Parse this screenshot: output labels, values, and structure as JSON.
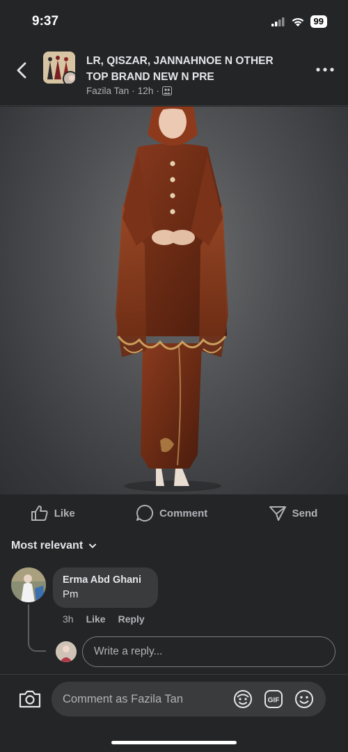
{
  "status_bar": {
    "time": "9:37",
    "battery": "99"
  },
  "header": {
    "title": "LR, QISZAR, JANNAHNOE N OTHER TOP BRAND NEW N PRE",
    "author": "Fazila Tan",
    "time": "12h",
    "separator": "·"
  },
  "photo": {
    "description_icon": "product-photo"
  },
  "actions": {
    "like": "Like",
    "comment": "Comment",
    "send": "Send"
  },
  "comments": {
    "sort_label": "Most relevant",
    "items": [
      {
        "author": "Erma Abd Ghani",
        "text": "Pm",
        "time": "3h",
        "like": "Like",
        "reply": "Reply"
      }
    ],
    "reply_placeholder": "Write a reply..."
  },
  "bottom_bar": {
    "placeholder": "Comment as Fazila Tan",
    "gif_label": "GIF"
  },
  "colors": {
    "background": "#242526",
    "bubble": "#3a3b3c",
    "muted": "#b0b3b8"
  }
}
